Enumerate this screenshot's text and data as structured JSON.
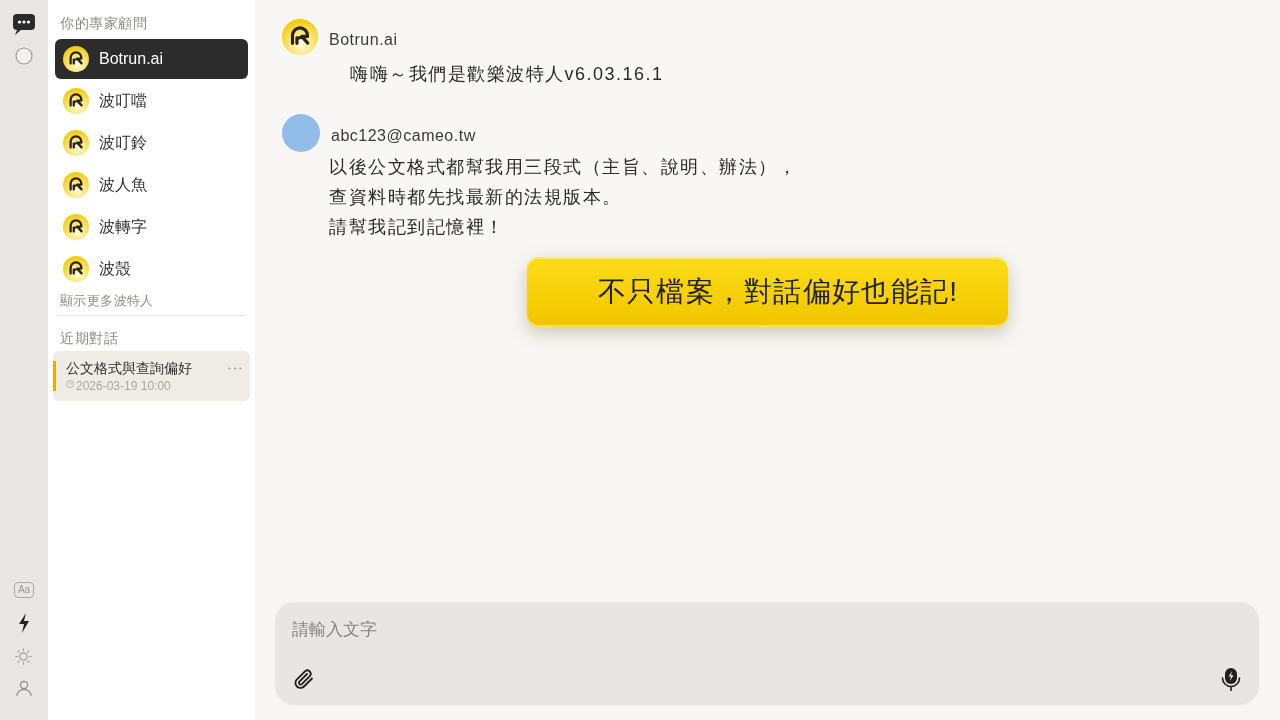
{
  "rail": {
    "text_size_button": "Aa"
  },
  "sidebar": {
    "experts_heading": "你的專家顧問",
    "experts": [
      {
        "name": "Botrun.ai",
        "selected": true
      },
      {
        "name": "波叮噹",
        "selected": false
      },
      {
        "name": "波叮鈴",
        "selected": false
      },
      {
        "name": "波人魚",
        "selected": false
      },
      {
        "name": "波轉字",
        "selected": false
      },
      {
        "name": "波殼",
        "selected": false
      }
    ],
    "show_more": "顯示更多波特人",
    "recent_heading": "近期對話",
    "conversations": [
      {
        "title": "公文格式與查詢偏好",
        "time": "2026-03-19 10:00",
        "selected": true
      }
    ]
  },
  "messages": [
    {
      "kind": "bot",
      "sender": "Botrun.ai",
      "lines": [
        "嗨嗨～我們是歡樂波特人v6.03.16.1"
      ]
    },
    {
      "kind": "user",
      "sender": "abc123@cameo.tw",
      "lines": [
        "以後公文格式都幫我用三段式（主旨、說明、辦法），",
        "查資料時都先找最新的法規版本。",
        "請幫我記到記憶裡！"
      ]
    }
  ],
  "caption": "不只檔案，對話偏好也能記!",
  "composer": {
    "placeholder": "請輸入文字"
  }
}
